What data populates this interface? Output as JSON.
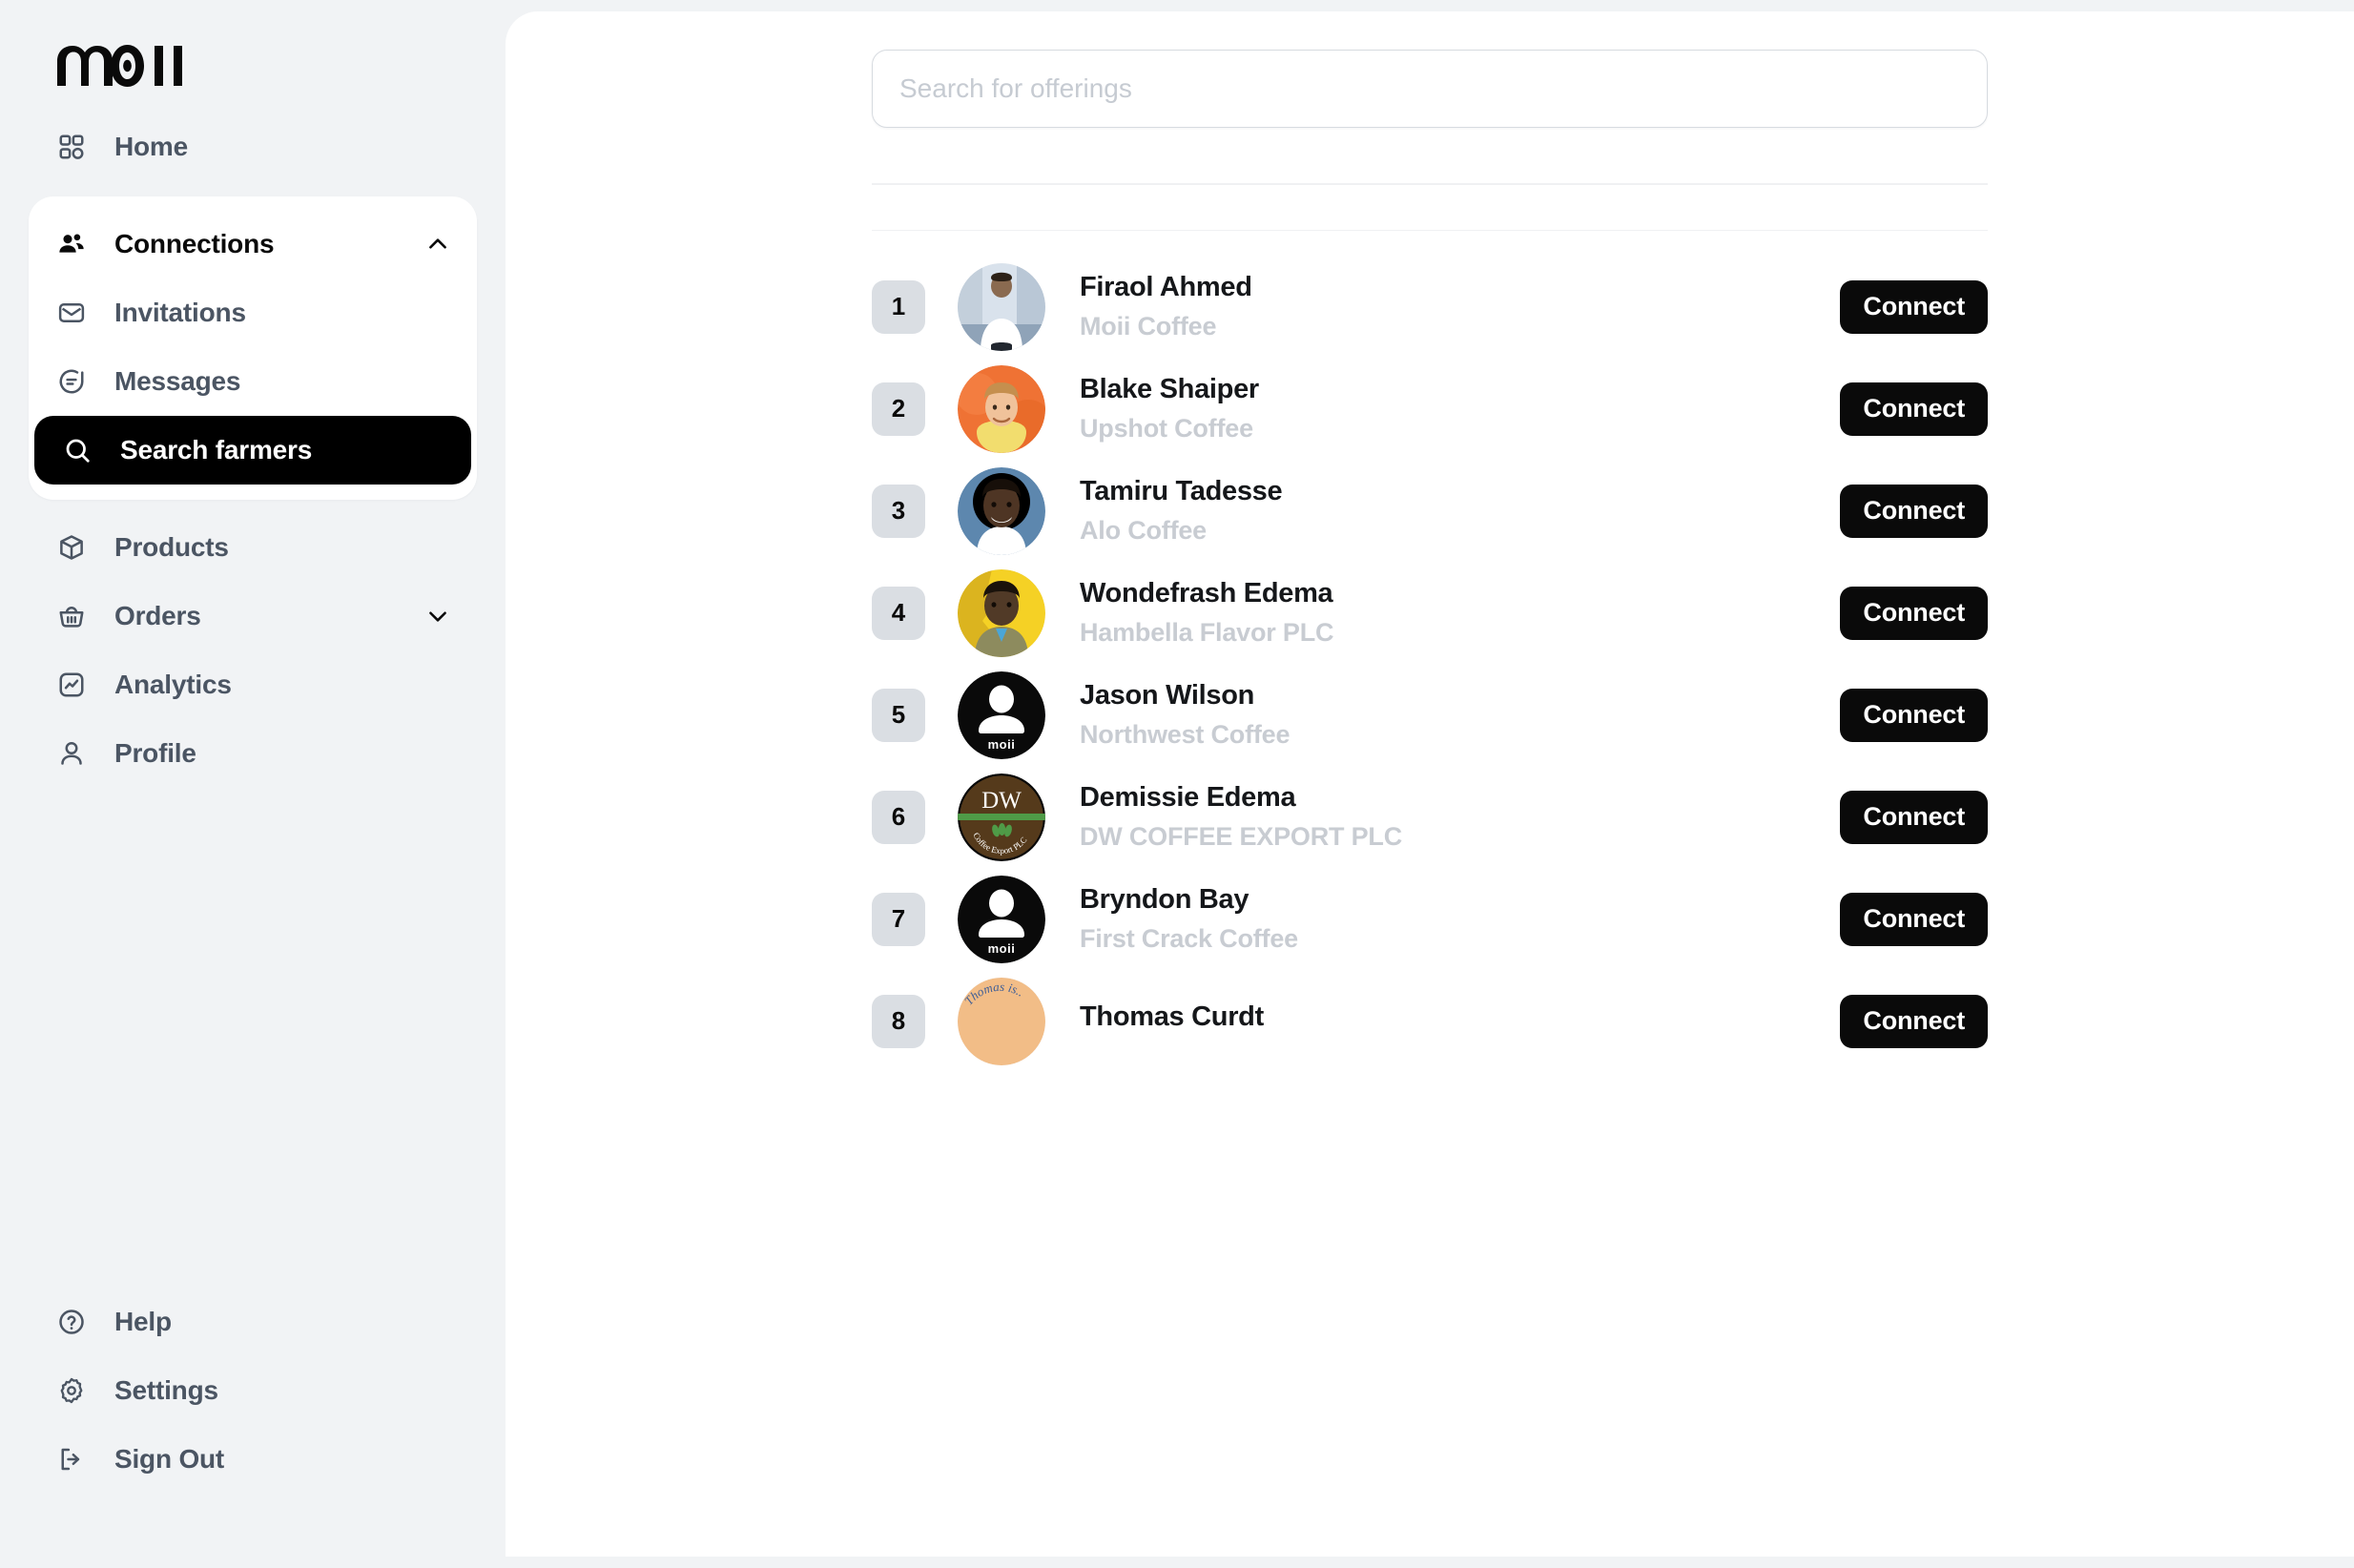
{
  "brand": {
    "logo_text": "moii"
  },
  "sidebar": {
    "top_items": [
      {
        "label": "Home",
        "icon": "grid-icon"
      }
    ],
    "group": {
      "header": {
        "label": "Connections",
        "icon": "users-icon",
        "chevron": "chevron-up-icon"
      },
      "items": [
        {
          "label": "Invitations",
          "icon": "envelope-icon",
          "active": false
        },
        {
          "label": "Messages",
          "icon": "message-icon",
          "active": false
        },
        {
          "label": "Search farmers",
          "icon": "search-icon",
          "active": true
        }
      ]
    },
    "mid_items": [
      {
        "label": "Products",
        "icon": "box-icon",
        "chevron": ""
      },
      {
        "label": "Orders",
        "icon": "basket-icon",
        "chevron": "chevron-down-icon"
      },
      {
        "label": "Analytics",
        "icon": "analytics-icon",
        "chevron": ""
      },
      {
        "label": "Profile",
        "icon": "user-icon",
        "chevron": ""
      }
    ],
    "bottom_items": [
      {
        "label": "Help",
        "icon": "help-circle-icon"
      },
      {
        "label": "Settings",
        "icon": "gear-icon"
      },
      {
        "label": "Sign Out",
        "icon": "sign-out-icon"
      }
    ]
  },
  "search": {
    "placeholder": "Search for offerings",
    "value": ""
  },
  "results": {
    "connect_label": "Connect",
    "rows": [
      {
        "rank": "1",
        "name": "Firaol Ahmed",
        "company": "Moii Coffee",
        "avatar": "photo-firaol",
        "action": "Connect"
      },
      {
        "rank": "2",
        "name": "Blake Shaiper",
        "company": "Upshot Coffee",
        "avatar": "photo-blake",
        "action": "Connect"
      },
      {
        "rank": "3",
        "name": "Tamiru Tadesse",
        "company": "Alo Coffee",
        "avatar": "photo-tamiru",
        "action": "Connect"
      },
      {
        "rank": "4",
        "name": "Wondefrash Edema",
        "company": "Hambella Flavor PLC",
        "avatar": "photo-wondefrash",
        "action": "Connect"
      },
      {
        "rank": "5",
        "name": "Jason Wilson",
        "company": "Northwest Coffee",
        "avatar": "moii-default",
        "action": "Connect"
      },
      {
        "rank": "6",
        "name": "Demissie Edema",
        "company": "DW COFFEE EXPORT PLC",
        "avatar": "dw-logo",
        "action": "Connect"
      },
      {
        "rank": "7",
        "name": "Bryndon Bay",
        "company": "First Crack Coffee",
        "avatar": "moii-default",
        "action": "Connect"
      },
      {
        "rank": "8",
        "name": "Thomas Curdt",
        "company": "",
        "avatar": "thomas-logo",
        "action": "Connect"
      }
    ]
  },
  "colors": {
    "page_bg": "#f1f3f5",
    "panel_bg": "#ffffff",
    "accent_black": "#0a0a0a",
    "muted_text": "#c8ccd2",
    "rank_bg": "#dadee3"
  }
}
